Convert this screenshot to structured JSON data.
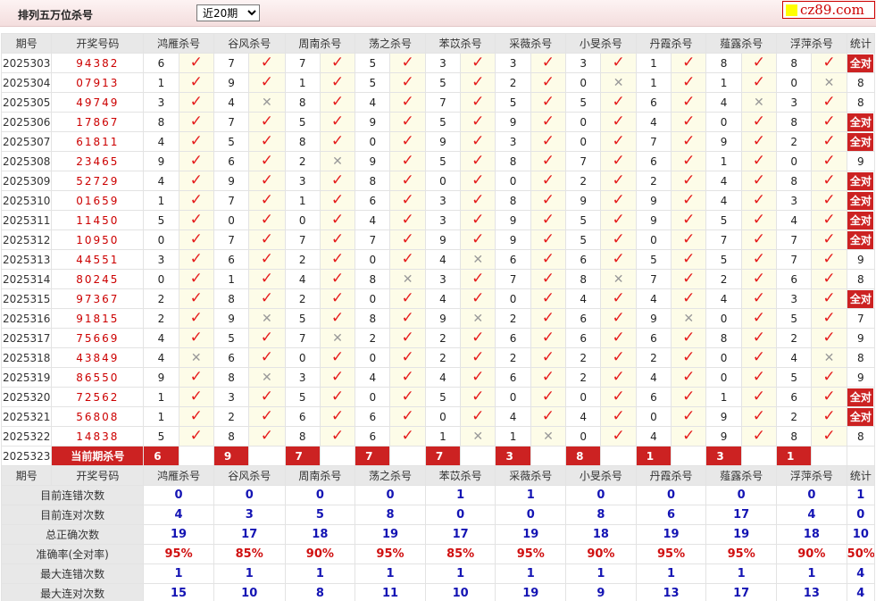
{
  "page": {
    "title": "排列五万位杀号",
    "select": "近20期",
    "logo": "cz89.com",
    "all_correct": "全对",
    "current_label": "当前期杀号"
  },
  "columns": [
    "期号",
    "开奖号码",
    "鸿雁杀号",
    "谷风杀号",
    "周南杀号",
    "荡之杀号",
    "苯苡杀号",
    "采薇杀号",
    "小旻杀号",
    "丹霞杀号",
    "薤露杀号",
    "浮萍杀号",
    "统计"
  ],
  "rows": [
    {
      "issue": "2025303",
      "draw": "94382",
      "kills": [
        6,
        7,
        7,
        5,
        3,
        3,
        3,
        1,
        8,
        8
      ],
      "hits": [
        1,
        1,
        1,
        1,
        1,
        1,
        1,
        1,
        1,
        1
      ],
      "stat": "全对"
    },
    {
      "issue": "2025304",
      "draw": "07913",
      "kills": [
        1,
        9,
        1,
        5,
        5,
        2,
        0,
        1,
        1,
        0
      ],
      "hits": [
        1,
        1,
        1,
        1,
        1,
        1,
        0,
        1,
        1,
        0
      ],
      "stat": "8"
    },
    {
      "issue": "2025305",
      "draw": "49749",
      "kills": [
        3,
        4,
        8,
        4,
        7,
        5,
        5,
        6,
        4,
        3
      ],
      "hits": [
        1,
        0,
        1,
        1,
        1,
        1,
        1,
        1,
        0,
        1
      ],
      "stat": "8"
    },
    {
      "issue": "2025306",
      "draw": "17867",
      "kills": [
        8,
        7,
        5,
        9,
        5,
        9,
        0,
        4,
        0,
        8
      ],
      "hits": [
        1,
        1,
        1,
        1,
        1,
        1,
        1,
        1,
        1,
        1
      ],
      "stat": "全对"
    },
    {
      "issue": "2025307",
      "draw": "61811",
      "kills": [
        4,
        5,
        8,
        0,
        9,
        3,
        0,
        7,
        9,
        2
      ],
      "hits": [
        1,
        1,
        1,
        1,
        1,
        1,
        1,
        1,
        1,
        1
      ],
      "stat": "全对"
    },
    {
      "issue": "2025308",
      "draw": "23465",
      "kills": [
        9,
        6,
        2,
        9,
        5,
        8,
        7,
        6,
        1,
        0
      ],
      "hits": [
        1,
        1,
        0,
        1,
        1,
        1,
        1,
        1,
        1,
        1
      ],
      "stat": "9"
    },
    {
      "issue": "2025309",
      "draw": "52729",
      "kills": [
        4,
        9,
        3,
        8,
        0,
        0,
        2,
        2,
        4,
        8
      ],
      "hits": [
        1,
        1,
        1,
        1,
        1,
        1,
        1,
        1,
        1,
        1
      ],
      "stat": "全对"
    },
    {
      "issue": "2025310",
      "draw": "01659",
      "kills": [
        1,
        7,
        1,
        6,
        3,
        8,
        9,
        9,
        4,
        3
      ],
      "hits": [
        1,
        1,
        1,
        1,
        1,
        1,
        1,
        1,
        1,
        1
      ],
      "stat": "全对"
    },
    {
      "issue": "2025311",
      "draw": "11450",
      "kills": [
        5,
        0,
        0,
        4,
        3,
        9,
        5,
        9,
        5,
        4
      ],
      "hits": [
        1,
        1,
        1,
        1,
        1,
        1,
        1,
        1,
        1,
        1
      ],
      "stat": "全对"
    },
    {
      "issue": "2025312",
      "draw": "10950",
      "kills": [
        0,
        7,
        7,
        7,
        9,
        9,
        5,
        0,
        7,
        7
      ],
      "hits": [
        1,
        1,
        1,
        1,
        1,
        1,
        1,
        1,
        1,
        1
      ],
      "stat": "全对"
    },
    {
      "issue": "2025313",
      "draw": "44551",
      "kills": [
        3,
        6,
        2,
        0,
        4,
        6,
        6,
        5,
        5,
        7
      ],
      "hits": [
        1,
        1,
        1,
        1,
        0,
        1,
        1,
        1,
        1,
        1
      ],
      "stat": "9"
    },
    {
      "issue": "2025314",
      "draw": "80245",
      "kills": [
        0,
        1,
        4,
        8,
        3,
        7,
        8,
        7,
        2,
        6
      ],
      "hits": [
        1,
        1,
        1,
        0,
        1,
        1,
        0,
        1,
        1,
        1
      ],
      "stat": "8"
    },
    {
      "issue": "2025315",
      "draw": "97367",
      "kills": [
        2,
        8,
        2,
        0,
        4,
        0,
        4,
        4,
        4,
        3
      ],
      "hits": [
        1,
        1,
        1,
        1,
        1,
        1,
        1,
        1,
        1,
        1
      ],
      "stat": "全对"
    },
    {
      "issue": "2025316",
      "draw": "91815",
      "kills": [
        2,
        9,
        5,
        8,
        9,
        2,
        6,
        9,
        0,
        5
      ],
      "hits": [
        1,
        0,
        1,
        1,
        0,
        1,
        1,
        0,
        1,
        1
      ],
      "stat": "7"
    },
    {
      "issue": "2025317",
      "draw": "75669",
      "kills": [
        4,
        5,
        7,
        2,
        2,
        6,
        6,
        6,
        8,
        2
      ],
      "hits": [
        1,
        1,
        0,
        1,
        1,
        1,
        1,
        1,
        1,
        1
      ],
      "stat": "9"
    },
    {
      "issue": "2025318",
      "draw": "43849",
      "kills": [
        4,
        6,
        0,
        0,
        2,
        2,
        2,
        2,
        0,
        4
      ],
      "hits": [
        0,
        1,
        1,
        1,
        1,
        1,
        1,
        1,
        1,
        0
      ],
      "stat": "8"
    },
    {
      "issue": "2025319",
      "draw": "86550",
      "kills": [
        9,
        8,
        3,
        4,
        4,
        6,
        2,
        4,
        0,
        5
      ],
      "hits": [
        1,
        0,
        1,
        1,
        1,
        1,
        1,
        1,
        1,
        1
      ],
      "stat": "9"
    },
    {
      "issue": "2025320",
      "draw": "72562",
      "kills": [
        1,
        3,
        5,
        0,
        5,
        0,
        0,
        6,
        1,
        6
      ],
      "hits": [
        1,
        1,
        1,
        1,
        1,
        1,
        1,
        1,
        1,
        1
      ],
      "stat": "全对"
    },
    {
      "issue": "2025321",
      "draw": "56808",
      "kills": [
        1,
        2,
        6,
        6,
        0,
        4,
        4,
        0,
        9,
        2
      ],
      "hits": [
        1,
        1,
        1,
        1,
        1,
        1,
        1,
        1,
        1,
        1
      ],
      "stat": "全对"
    },
    {
      "issue": "2025322",
      "draw": "14838",
      "kills": [
        5,
        8,
        8,
        6,
        1,
        1,
        0,
        4,
        9,
        8
      ],
      "hits": [
        1,
        1,
        1,
        1,
        0,
        0,
        1,
        1,
        1,
        1
      ],
      "stat": "8"
    }
  ],
  "current": {
    "issue": "2025323",
    "kills": [
      6,
      9,
      7,
      7,
      7,
      3,
      8,
      1,
      3,
      1
    ]
  },
  "stats": [
    {
      "label": "目前连错次数",
      "values": [
        "0",
        "0",
        "0",
        "0",
        "1",
        "1",
        "0",
        "0",
        "0",
        "0",
        "1"
      ]
    },
    {
      "label": "目前连对次数",
      "values": [
        "4",
        "3",
        "5",
        "8",
        "0",
        "0",
        "8",
        "6",
        "17",
        "4",
        "0"
      ]
    },
    {
      "label": "总正确次数",
      "values": [
        "19",
        "17",
        "18",
        "19",
        "17",
        "19",
        "18",
        "19",
        "19",
        "18",
        "10"
      ]
    },
    {
      "label": "准确率(全对率)",
      "values": [
        "95%",
        "85%",
        "90%",
        "95%",
        "85%",
        "95%",
        "90%",
        "95%",
        "95%",
        "90%",
        "50%"
      ]
    },
    {
      "label": "最大连错次数",
      "values": [
        "1",
        "1",
        "1",
        "1",
        "1",
        "1",
        "1",
        "1",
        "1",
        "1",
        "4"
      ]
    },
    {
      "label": "最大连对次数",
      "values": [
        "15",
        "10",
        "8",
        "11",
        "10",
        "19",
        "9",
        "13",
        "17",
        "13",
        "4"
      ]
    }
  ],
  "colors": {
    "accent_red": "#cc2222",
    "check_red": "#e51c1c",
    "stat_blue": "#1414b4",
    "rate_red": "#d01010",
    "result_bg": "#fdfce8",
    "header_bg": "#e8e8e8"
  },
  "icons": {
    "hit": "check-icon",
    "miss": "cross-icon"
  }
}
